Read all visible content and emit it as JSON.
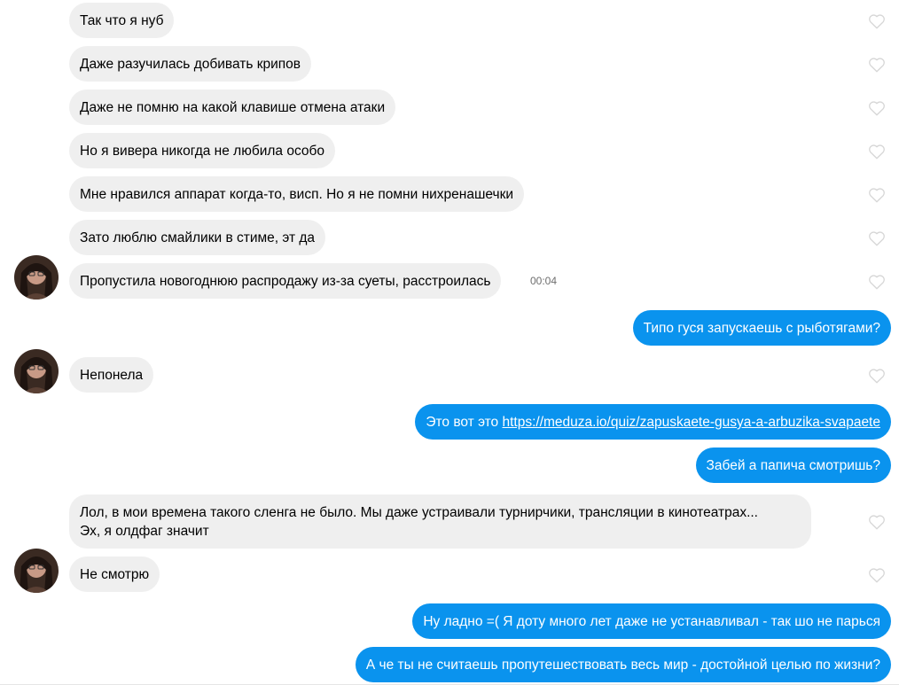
{
  "messages": [
    {
      "side": "in",
      "text": "Так что я нуб"
    },
    {
      "side": "in",
      "text": "Даже разучилась добивать крипов"
    },
    {
      "side": "in",
      "text": "Даже не помню на какой клавише отмена атаки"
    },
    {
      "side": "in",
      "text": "Но я вивера никогда не любила особо"
    },
    {
      "side": "in",
      "text": "Мне нравился аппарат когда-то, висп. Но я не помни нихренашечки"
    },
    {
      "side": "in",
      "text": "Зато люблю смайлики в стиме, эт да"
    },
    {
      "side": "in",
      "text": "Пропустила новогоднюю распродажу из-за суеты, расстроилась",
      "time": "00:04"
    },
    {
      "side": "out",
      "text": "Типо гуся запускаешь с рыботягами?"
    },
    {
      "side": "in",
      "text": "Непонела"
    },
    {
      "side": "out",
      "prefix": "Это вот это ",
      "link": "https://meduza.io/quiz/zapuskaete-gusya-a-arbuzika-svapaete"
    },
    {
      "side": "out",
      "text": "Забей а папича смотришь?"
    },
    {
      "side": "in",
      "line1": "Лол, в мои времена такого сленга не было. Мы даже устраивали турнирчики, трансляции в кинотеатрах...",
      "line2": "Эх, я олдфаг значит"
    },
    {
      "side": "in",
      "text": "Не смотрю"
    },
    {
      "side": "out",
      "text": "Ну ладно =( Я доту много лет даже не устанавливал - так шо не парься"
    },
    {
      "side": "out",
      "text": "А че ты не считаешь пропутешествовать весь мир - достойной целью по жизни?"
    }
  ],
  "colors": {
    "incoming": "#efefef",
    "outgoing": "#0a93ee",
    "heart": "#d6d6d6"
  },
  "icons": {
    "like": "heart-outline-icon",
    "avatar": "contact-avatar"
  }
}
